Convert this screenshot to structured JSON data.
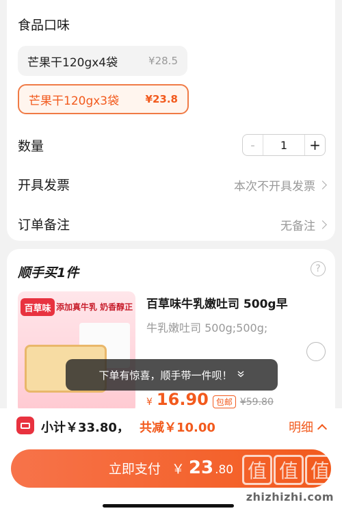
{
  "flavor": {
    "title": "食品口味",
    "options": [
      {
        "name": "芒果干120gx4袋",
        "price": "¥28.5",
        "selected": false
      },
      {
        "name": "芒果干120gx3袋",
        "price": "¥23.8",
        "selected": true
      }
    ]
  },
  "quantity": {
    "label": "数量",
    "minus": "-",
    "value": "1",
    "plus": "+"
  },
  "invoice": {
    "label": "开具发票",
    "value": "本次不开具发票"
  },
  "remark": {
    "label": "订单备注",
    "value": "无备注"
  },
  "addon": {
    "title": "顺手买1件",
    "help": "?",
    "product": {
      "brand_logo": "百草味",
      "image_slogan": "添加真牛乳  奶香醇正",
      "name": "百草味牛乳嫩吐司 500g早",
      "spec": "牛乳嫩吐司 500g;500g;",
      "price_symbol": "¥",
      "price": "16.90",
      "badge": "包邮",
      "original_price": "¥59.80"
    }
  },
  "toast": {
    "text": "下单有惊喜，顺手带一件呗！",
    "icon": "chevron-double-down-icon"
  },
  "summary": {
    "subtotal": "小计￥33.80，",
    "reduction": "共减￥10.00",
    "detail": "明细"
  },
  "pay_button": {
    "label": "立即支付",
    "symbol": "￥",
    "integer": "23",
    "decimal": ".80"
  },
  "watermark": {
    "chars": [
      "值",
      "值",
      "值"
    ],
    "url": "zhizhizhi.com"
  },
  "colors": {
    "accent": "#f25a1d",
    "brand_red": "#e8323f",
    "background": "#f2f2f2"
  }
}
